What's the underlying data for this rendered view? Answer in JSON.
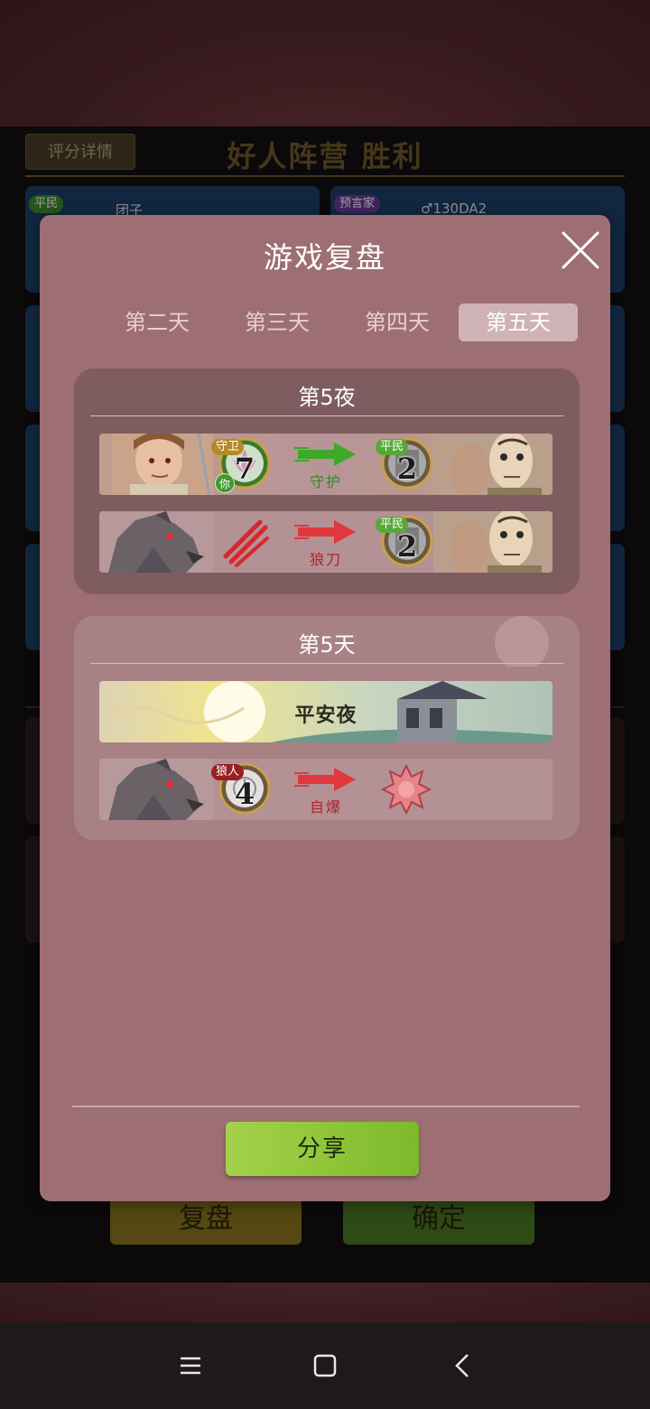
{
  "background": {
    "score_button": "评分详情",
    "result_title": "好人阵营 胜利",
    "player_cards": [
      {
        "role": "平民",
        "name": "团子"
      },
      {
        "role": "预言家",
        "name": "♂130DA2"
      }
    ],
    "buttons": {
      "replay": "复盘",
      "confirm": "确定"
    }
  },
  "modal": {
    "title": "游戏复盘",
    "tabs": [
      {
        "label": "第二天",
        "active": false
      },
      {
        "label": "第三天",
        "active": false
      },
      {
        "label": "第四天",
        "active": false
      },
      {
        "label": "第五天",
        "active": true
      }
    ],
    "night": {
      "title": "第5夜",
      "events": [
        {
          "actor_role": "守卫",
          "actor_number": "7",
          "actor_you": "你",
          "action": "守护",
          "target_role": "平民",
          "target_number": "2"
        },
        {
          "actor_role": "",
          "actor_number": "",
          "action": "狼刀",
          "target_role": "平民",
          "target_number": "2"
        }
      ]
    },
    "day": {
      "title": "第5天",
      "safe_night": "平安夜",
      "events": [
        {
          "actor_role": "狼人",
          "actor_number": "4",
          "action": "自爆"
        }
      ]
    },
    "share": "分享"
  },
  "colors": {
    "modal_bg": "#9d6f73",
    "share_green": "#8bc43a",
    "protect_green": "#3f9d2a",
    "kill_red": "#d9363a"
  }
}
